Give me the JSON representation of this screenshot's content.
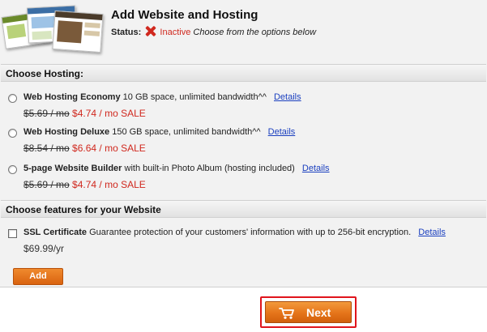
{
  "header": {
    "title": "Add Website and Hosting",
    "status_label": "Status:",
    "status_value": "Inactive",
    "status_hint": "Choose from the options below",
    "status_icon": "x-icon",
    "thumbnail_icon": "website-templates-thumbnail"
  },
  "hosting": {
    "section_title": "Choose Hosting:",
    "options": [
      {
        "name": "Web Hosting Economy",
        "desc": "10 GB space, unlimited bandwidth^^",
        "details": "Details",
        "old_price": "$5.69 / mo",
        "new_price": "$4.74 / mo SALE",
        "selected": false
      },
      {
        "name": "Web Hosting Deluxe",
        "desc": "150 GB space, unlimited bandwidth^^",
        "details": "Details",
        "old_price": "$8.54 / mo",
        "new_price": "$6.64 / mo SALE",
        "selected": false
      },
      {
        "name": "5-page Website Builder",
        "desc": "with built-in Photo Album (hosting included)",
        "details": "Details",
        "old_price": "$5.69 / mo",
        "new_price": "$4.74 / mo SALE",
        "selected": false
      }
    ]
  },
  "features": {
    "section_title": "Choose features for your Website",
    "items": [
      {
        "name": "SSL Certificate",
        "desc": "Guarantee protection of your customers' information with up to 256-bit encryption.",
        "details": "Details",
        "price": "$69.99/yr",
        "checked": false
      }
    ],
    "add_label": "Add"
  },
  "footer": {
    "next_label": "Next",
    "next_icon": "shopping-cart-icon"
  },
  "colors": {
    "accent_orange": "#e5741a",
    "sale_red": "#d0281e",
    "link_blue": "#1a3fbf",
    "highlight_frame": "#e0141c"
  }
}
